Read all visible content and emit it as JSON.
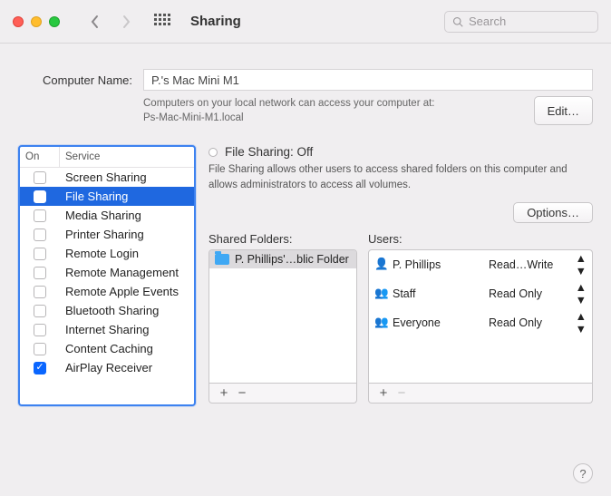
{
  "titlebar": {
    "title": "Sharing",
    "search_placeholder": "Search"
  },
  "computer_name": {
    "label": "Computer Name:",
    "value": "P.'s Mac Mini M1",
    "hint_line1": "Computers on your local network can access your computer at:",
    "hint_line2": "Ps-Mac-Mini-M1.local",
    "edit_label": "Edit…"
  },
  "services": {
    "header_on": "On",
    "header_service": "Service",
    "items": [
      {
        "label": "Screen Sharing",
        "checked": false,
        "selected": false
      },
      {
        "label": "File Sharing",
        "checked": false,
        "selected": true
      },
      {
        "label": "Media Sharing",
        "checked": false,
        "selected": false
      },
      {
        "label": "Printer Sharing",
        "checked": false,
        "selected": false
      },
      {
        "label": "Remote Login",
        "checked": false,
        "selected": false
      },
      {
        "label": "Remote Management",
        "checked": false,
        "selected": false
      },
      {
        "label": "Remote Apple Events",
        "checked": false,
        "selected": false
      },
      {
        "label": "Bluetooth Sharing",
        "checked": false,
        "selected": false
      },
      {
        "label": "Internet Sharing",
        "checked": false,
        "selected": false
      },
      {
        "label": "Content Caching",
        "checked": false,
        "selected": false
      },
      {
        "label": "AirPlay Receiver",
        "checked": true,
        "selected": false
      }
    ]
  },
  "detail": {
    "status_title": "File Sharing: Off",
    "description": "File Sharing allows other users to access shared folders on this computer and allows administrators to access all volumes.",
    "options_label": "Options…",
    "shared_folders_label": "Shared Folders:",
    "users_label": "Users:",
    "folders": [
      {
        "label": "P. Phillips'…blic Folder"
      }
    ],
    "users": [
      {
        "icon": "person",
        "name": "P. Phillips",
        "perm": "Read…Write"
      },
      {
        "icon": "group",
        "name": "Staff",
        "perm": "Read Only"
      },
      {
        "icon": "group3",
        "name": "Everyone",
        "perm": "Read Only"
      }
    ],
    "plus": "+",
    "minus": "−"
  },
  "help": "?"
}
